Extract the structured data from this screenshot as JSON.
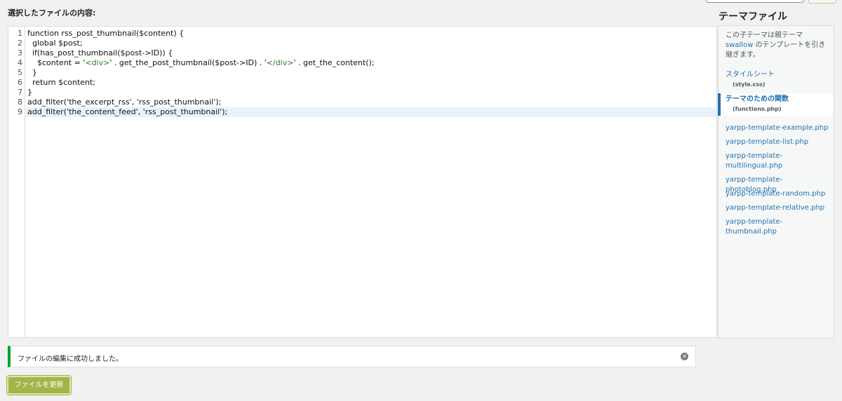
{
  "editor": {
    "label": "選択したファイルの内容:",
    "lines": [
      {
        "no": "1",
        "text": "function rss_post_thumbnail($content) {"
      },
      {
        "no": "2",
        "text": "  global $post;"
      },
      {
        "no": "3",
        "text": "  if(has_post_thumbnail($post->ID)) {"
      },
      {
        "no": "4",
        "pre": "    $content = '",
        "tag1": "<div>",
        "mid": "' . get_the_post_thumbnail($post->ID) . '",
        "tag2": "</div>",
        "post": "' . get_the_content();"
      },
      {
        "no": "5",
        "text": "  }"
      },
      {
        "no": "6",
        "text": "  return $content;"
      },
      {
        "no": "7",
        "text": "}"
      },
      {
        "no": "8",
        "text": "add_filter('the_excerpt_rss', 'rss_post_thumbnail');"
      },
      {
        "no": "9",
        "text": "add_filter('the_content_feed', 'rss_post_thumbnail');"
      }
    ]
  },
  "sidebar": {
    "title": "テーマファイル",
    "note_before": "この子テーマは親テーマ ",
    "parent_link": "swallow",
    "note_after": " のテンプレートを引き継ぎます。",
    "files": [
      {
        "label": "スタイルシート",
        "sub": "(style.css)"
      },
      {
        "label": "テーマのための関数",
        "sub": "(functions.php)"
      },
      {
        "label": "yarpp-template-example.php"
      },
      {
        "label": "yarpp-template-list.php"
      },
      {
        "label": "yarpp-template-multilingual.php"
      },
      {
        "label": "yarpp-template-photoblog.php"
      },
      {
        "label": "yarpp-template-random.php"
      },
      {
        "label": "yarpp-template-relative.php"
      },
      {
        "label": "yarpp-template-thumbnail.php"
      }
    ]
  },
  "notice": {
    "text": "ファイルの編集に成功しました。",
    "dismiss_icon": "close-circle-icon"
  },
  "actions": {
    "update_label": "ファイルを更新"
  },
  "colors": {
    "accent": "#2271b1",
    "success": "#00a32a",
    "button": "#a3b449"
  }
}
